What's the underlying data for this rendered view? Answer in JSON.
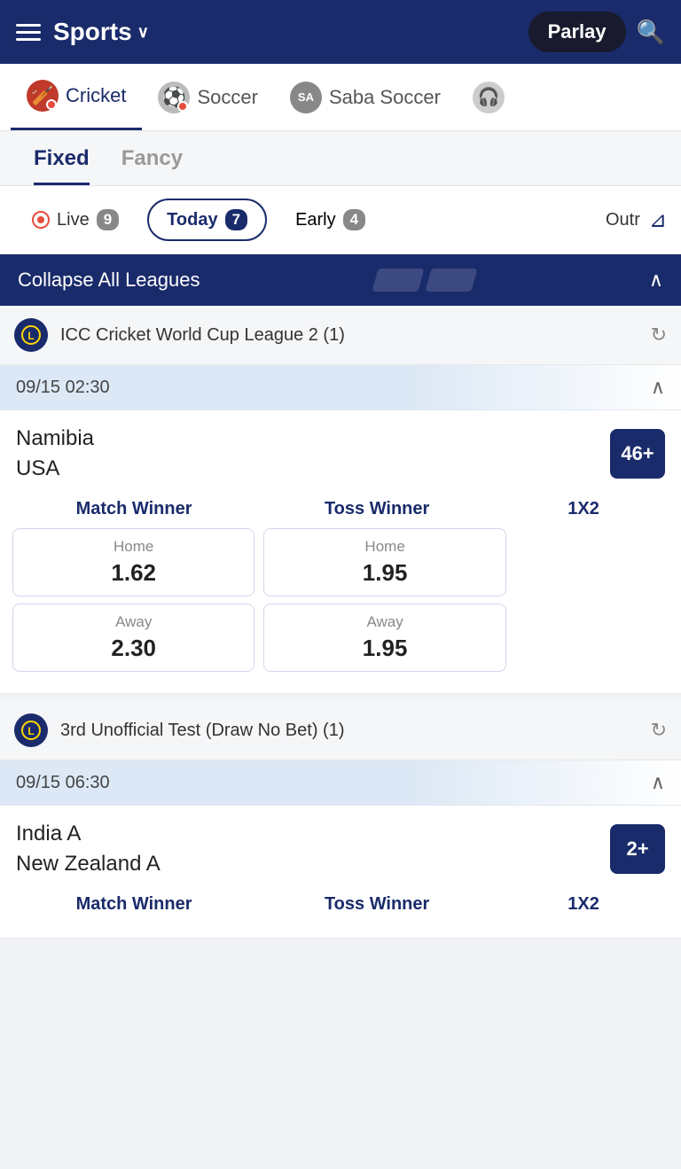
{
  "header": {
    "title": "Sports",
    "parlay_label": "Parlay",
    "hamburger_label": "Menu"
  },
  "sports_tabs": [
    {
      "id": "cricket",
      "label": "Cricket",
      "icon": "🏏",
      "active": true
    },
    {
      "id": "soccer",
      "label": "Soccer",
      "icon": "⚽",
      "active": false
    },
    {
      "id": "saba-soccer",
      "label": "Saba Soccer",
      "icon": "SA",
      "active": false
    },
    {
      "id": "headset",
      "label": "",
      "icon": "🎧",
      "active": false
    }
  ],
  "sub_tabs": [
    {
      "id": "fixed",
      "label": "Fixed",
      "active": true
    },
    {
      "id": "fancy",
      "label": "Fancy",
      "active": false
    }
  ],
  "filter_bar": {
    "live_label": "Live",
    "live_count": "9",
    "today_label": "Today",
    "today_count": "7",
    "early_label": "Early",
    "early_count": "4",
    "outrights_label": "Outr"
  },
  "collapse_bar": {
    "label": "Collapse All Leagues"
  },
  "matches": [
    {
      "league": "ICC Cricket World Cup League 2 (1)",
      "datetime": "09/15 02:30",
      "team1": "Namibia",
      "team2": "USA",
      "market_count": "46+",
      "markets": [
        {
          "header": "Match Winner",
          "bets": [
            {
              "label": "Home",
              "value": "1.62"
            },
            {
              "label": "Away",
              "value": "2.30"
            }
          ]
        },
        {
          "header": "Toss Winner",
          "bets": [
            {
              "label": "Home",
              "value": "1.95"
            },
            {
              "label": "Away",
              "value": "1.95"
            }
          ]
        },
        {
          "header": "1X2",
          "bets": []
        }
      ]
    },
    {
      "league": "3rd Unofficial Test (Draw No Bet) (1)",
      "datetime": "09/15 06:30",
      "team1": "India A",
      "team2": "New Zealand A",
      "market_count": "2+",
      "markets": [
        {
          "header": "Match Winner",
          "bets": []
        },
        {
          "header": "Toss Winner",
          "bets": []
        },
        {
          "header": "1X2",
          "bets": []
        }
      ]
    }
  ]
}
